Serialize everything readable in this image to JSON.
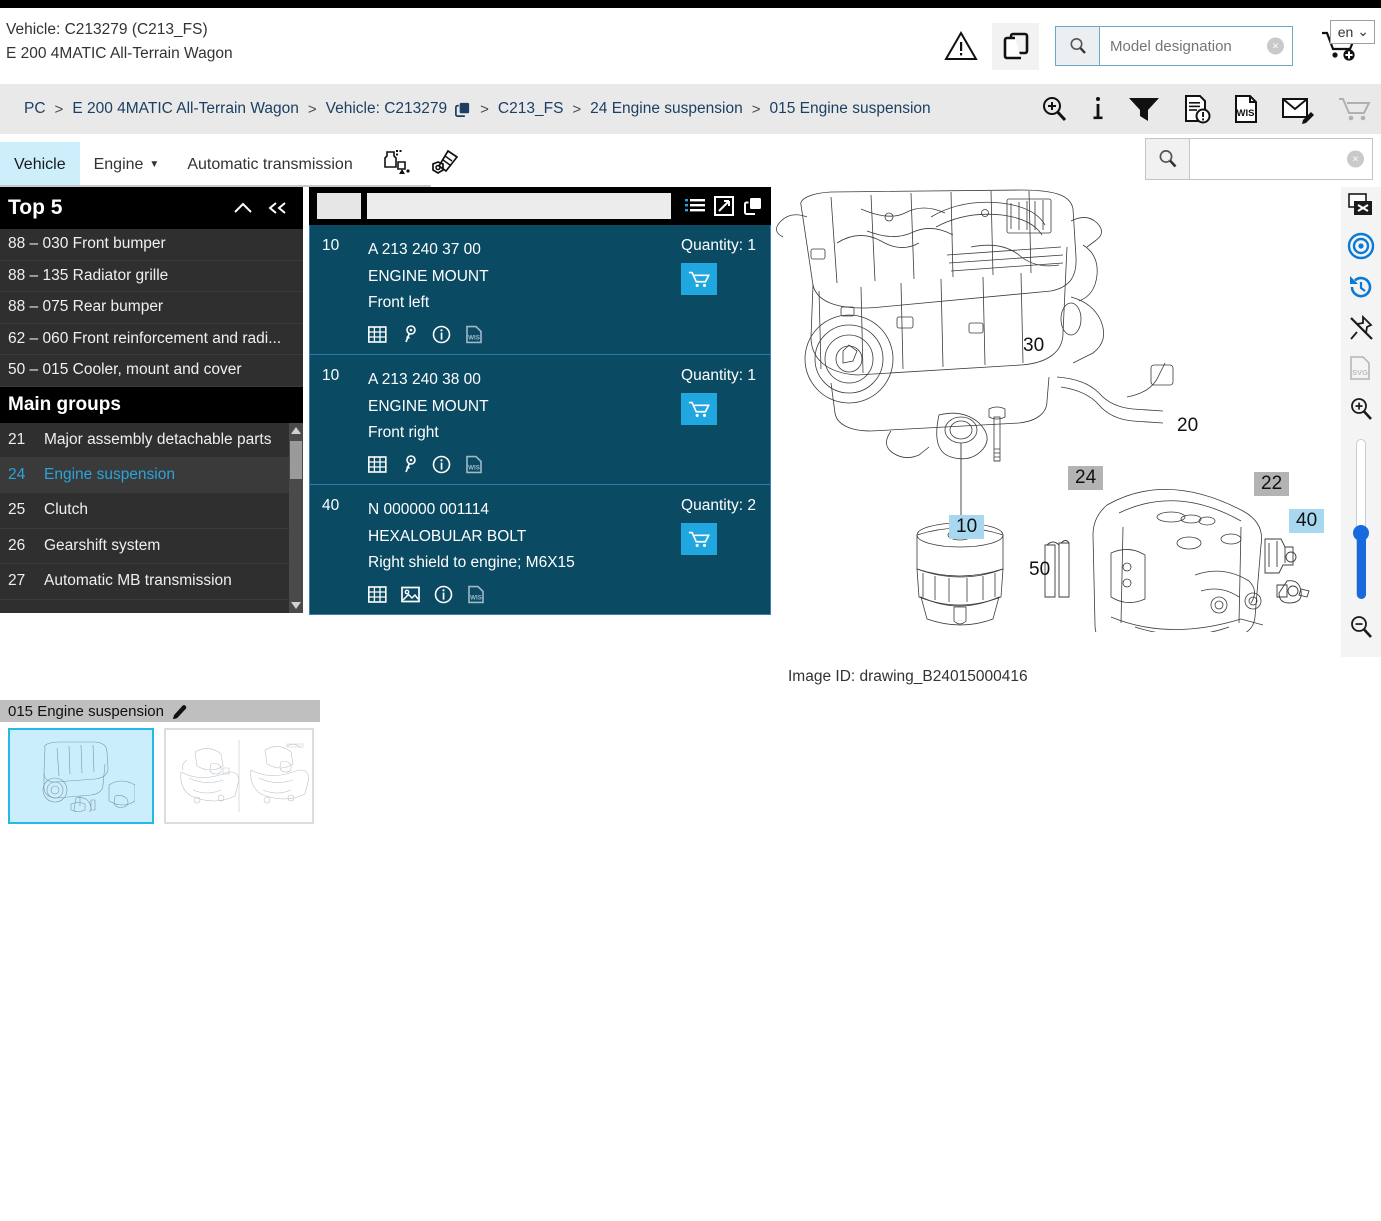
{
  "header": {
    "vehicle_line1": "Vehicle: C213279 (C213_FS)",
    "vehicle_line2": "E 200 4MATIC All-Terrain Wagon",
    "warning_icon": "warning-triangle-icon",
    "copy_icon": "copy-documents-icon",
    "model_search": {
      "icon": "search-icon",
      "value": "",
      "placeholder": "Model designation",
      "clear_label": "×"
    },
    "cart_icon": "add-to-cart-icon",
    "language": "en",
    "language_caret": "⌄"
  },
  "breadcrumb": {
    "items": [
      {
        "label": "PC",
        "icon": null
      },
      {
        "label": "E 200 4MATIC All-Terrain Wagon",
        "icon": null
      },
      {
        "label": "Vehicle: C213279",
        "icon": "copy-icon"
      },
      {
        "label": "C213_FS",
        "icon": null
      },
      {
        "label": "24 Engine suspension",
        "icon": null
      },
      {
        "label": "015 Engine suspension",
        "icon": null
      }
    ],
    "separator": ">",
    "tools": [
      {
        "name": "zoom-in-search-icon"
      },
      {
        "name": "info-icon"
      },
      {
        "name": "filter-funnel-icon"
      },
      {
        "name": "document-alert-icon"
      },
      {
        "name": "wis-document-icon"
      },
      {
        "name": "email-edit-icon"
      },
      {
        "name": "shopping-cart-icon"
      }
    ]
  },
  "tabs": {
    "items": [
      {
        "label": "Vehicle",
        "active": true,
        "caret": false
      },
      {
        "label": "Engine",
        "active": false,
        "caret": true
      },
      {
        "label": "Automatic transmission",
        "active": false,
        "caret": false
      }
    ],
    "caret_glyph": "▼",
    "icons": [
      {
        "name": "oil-fluids-icon"
      },
      {
        "name": "bolts-fasteners-icon"
      }
    ],
    "search": {
      "icon": "search-icon",
      "value": "",
      "placeholder": "",
      "clear_label": "×"
    }
  },
  "sidebar": {
    "top5": {
      "title": "Top 5",
      "collapse_icon": "chevron-up-icon",
      "collapse_all_icon": "double-chevron-left-icon",
      "items": [
        "88 – 030 Front bumper",
        "88 – 135 Radiator grille",
        "88 – 075 Rear bumper",
        "62 – 060 Front reinforcement and radi...",
        "50 – 015 Cooler, mount and cover"
      ]
    },
    "main_groups": {
      "title": "Main groups",
      "items": [
        {
          "num": "21",
          "label": "Major assembly detachable parts",
          "selected": false
        },
        {
          "num": "24",
          "label": "Engine suspension",
          "selected": true
        },
        {
          "num": "25",
          "label": "Clutch",
          "selected": false
        },
        {
          "num": "26",
          "label": "Gearshift system",
          "selected": false
        },
        {
          "num": "27",
          "label": "Automatic MB transmission",
          "selected": false
        }
      ]
    }
  },
  "parts_panel": {
    "toolbar_icons": [
      {
        "name": "list-view-icon"
      },
      {
        "name": "expand-fullscreen-icon"
      },
      {
        "name": "copy-icon"
      }
    ],
    "rows": [
      {
        "pos": "10",
        "part_number": "A 213 240 37 00",
        "name": "ENGINE MOUNT",
        "description": "Front left",
        "quantity_label": "Quantity: 1",
        "cart_icon": "cart-icon",
        "icons": [
          {
            "name": "table-grid-icon"
          },
          {
            "name": "key-search-icon"
          },
          {
            "name": "info-circle-icon"
          },
          {
            "name": "wis-document-icon"
          }
        ]
      },
      {
        "pos": "10",
        "part_number": "A 213 240 38 00",
        "name": "ENGINE MOUNT",
        "description": "Front right",
        "quantity_label": "Quantity: 1",
        "cart_icon": "cart-icon",
        "icons": [
          {
            "name": "table-grid-icon"
          },
          {
            "name": "key-search-icon"
          },
          {
            "name": "info-circle-icon"
          },
          {
            "name": "wis-document-icon"
          }
        ]
      },
      {
        "pos": "40",
        "part_number": "N 000000 001114",
        "name": "HEXALOBULAR BOLT",
        "description": "Right shield to engine; M6X15",
        "quantity_label": "Quantity: 2",
        "cart_icon": "cart-icon",
        "icons": [
          {
            "name": "table-grid-icon"
          },
          {
            "name": "image-picture-icon"
          },
          {
            "name": "info-circle-icon"
          },
          {
            "name": "wis-document-icon"
          }
        ]
      }
    ]
  },
  "drawing": {
    "image_id_label": "Image ID: drawing_B24015000416",
    "callouts": [
      {
        "label": "30",
        "style": "plain"
      },
      {
        "label": "20",
        "style": "plain"
      },
      {
        "label": "50",
        "style": "plain"
      },
      {
        "label": "24",
        "style": "grey"
      },
      {
        "label": "22",
        "style": "grey"
      },
      {
        "label": "10",
        "style": "blue"
      },
      {
        "label": "40",
        "style": "blue"
      }
    ],
    "tools": [
      {
        "name": "close-window-icon"
      },
      {
        "name": "target-focus-icon"
      },
      {
        "name": "history-reset-icon"
      },
      {
        "name": "unpin-icon"
      },
      {
        "name": "svg-export-icon"
      },
      {
        "name": "zoom-in-icon"
      },
      {
        "name": "zoom-slider"
      },
      {
        "name": "zoom-out-icon"
      }
    ]
  },
  "thumbnails": {
    "title": "015 Engine suspension",
    "edit_icon": "edit-pencil-icon",
    "items": [
      {
        "name": "thumb-engine-suspension-1",
        "selected": true
      },
      {
        "name": "thumb-engine-suspension-2",
        "selected": false
      }
    ]
  },
  "colors": {
    "accent_blue": "#00a0df",
    "parts_bg": "#0a4a63",
    "cart_blue": "#21a7e0",
    "breadcrumb_link": "#1c3f63",
    "sidebar_bg": "#2b2b2b",
    "selected_group": "#2aa3dd"
  }
}
